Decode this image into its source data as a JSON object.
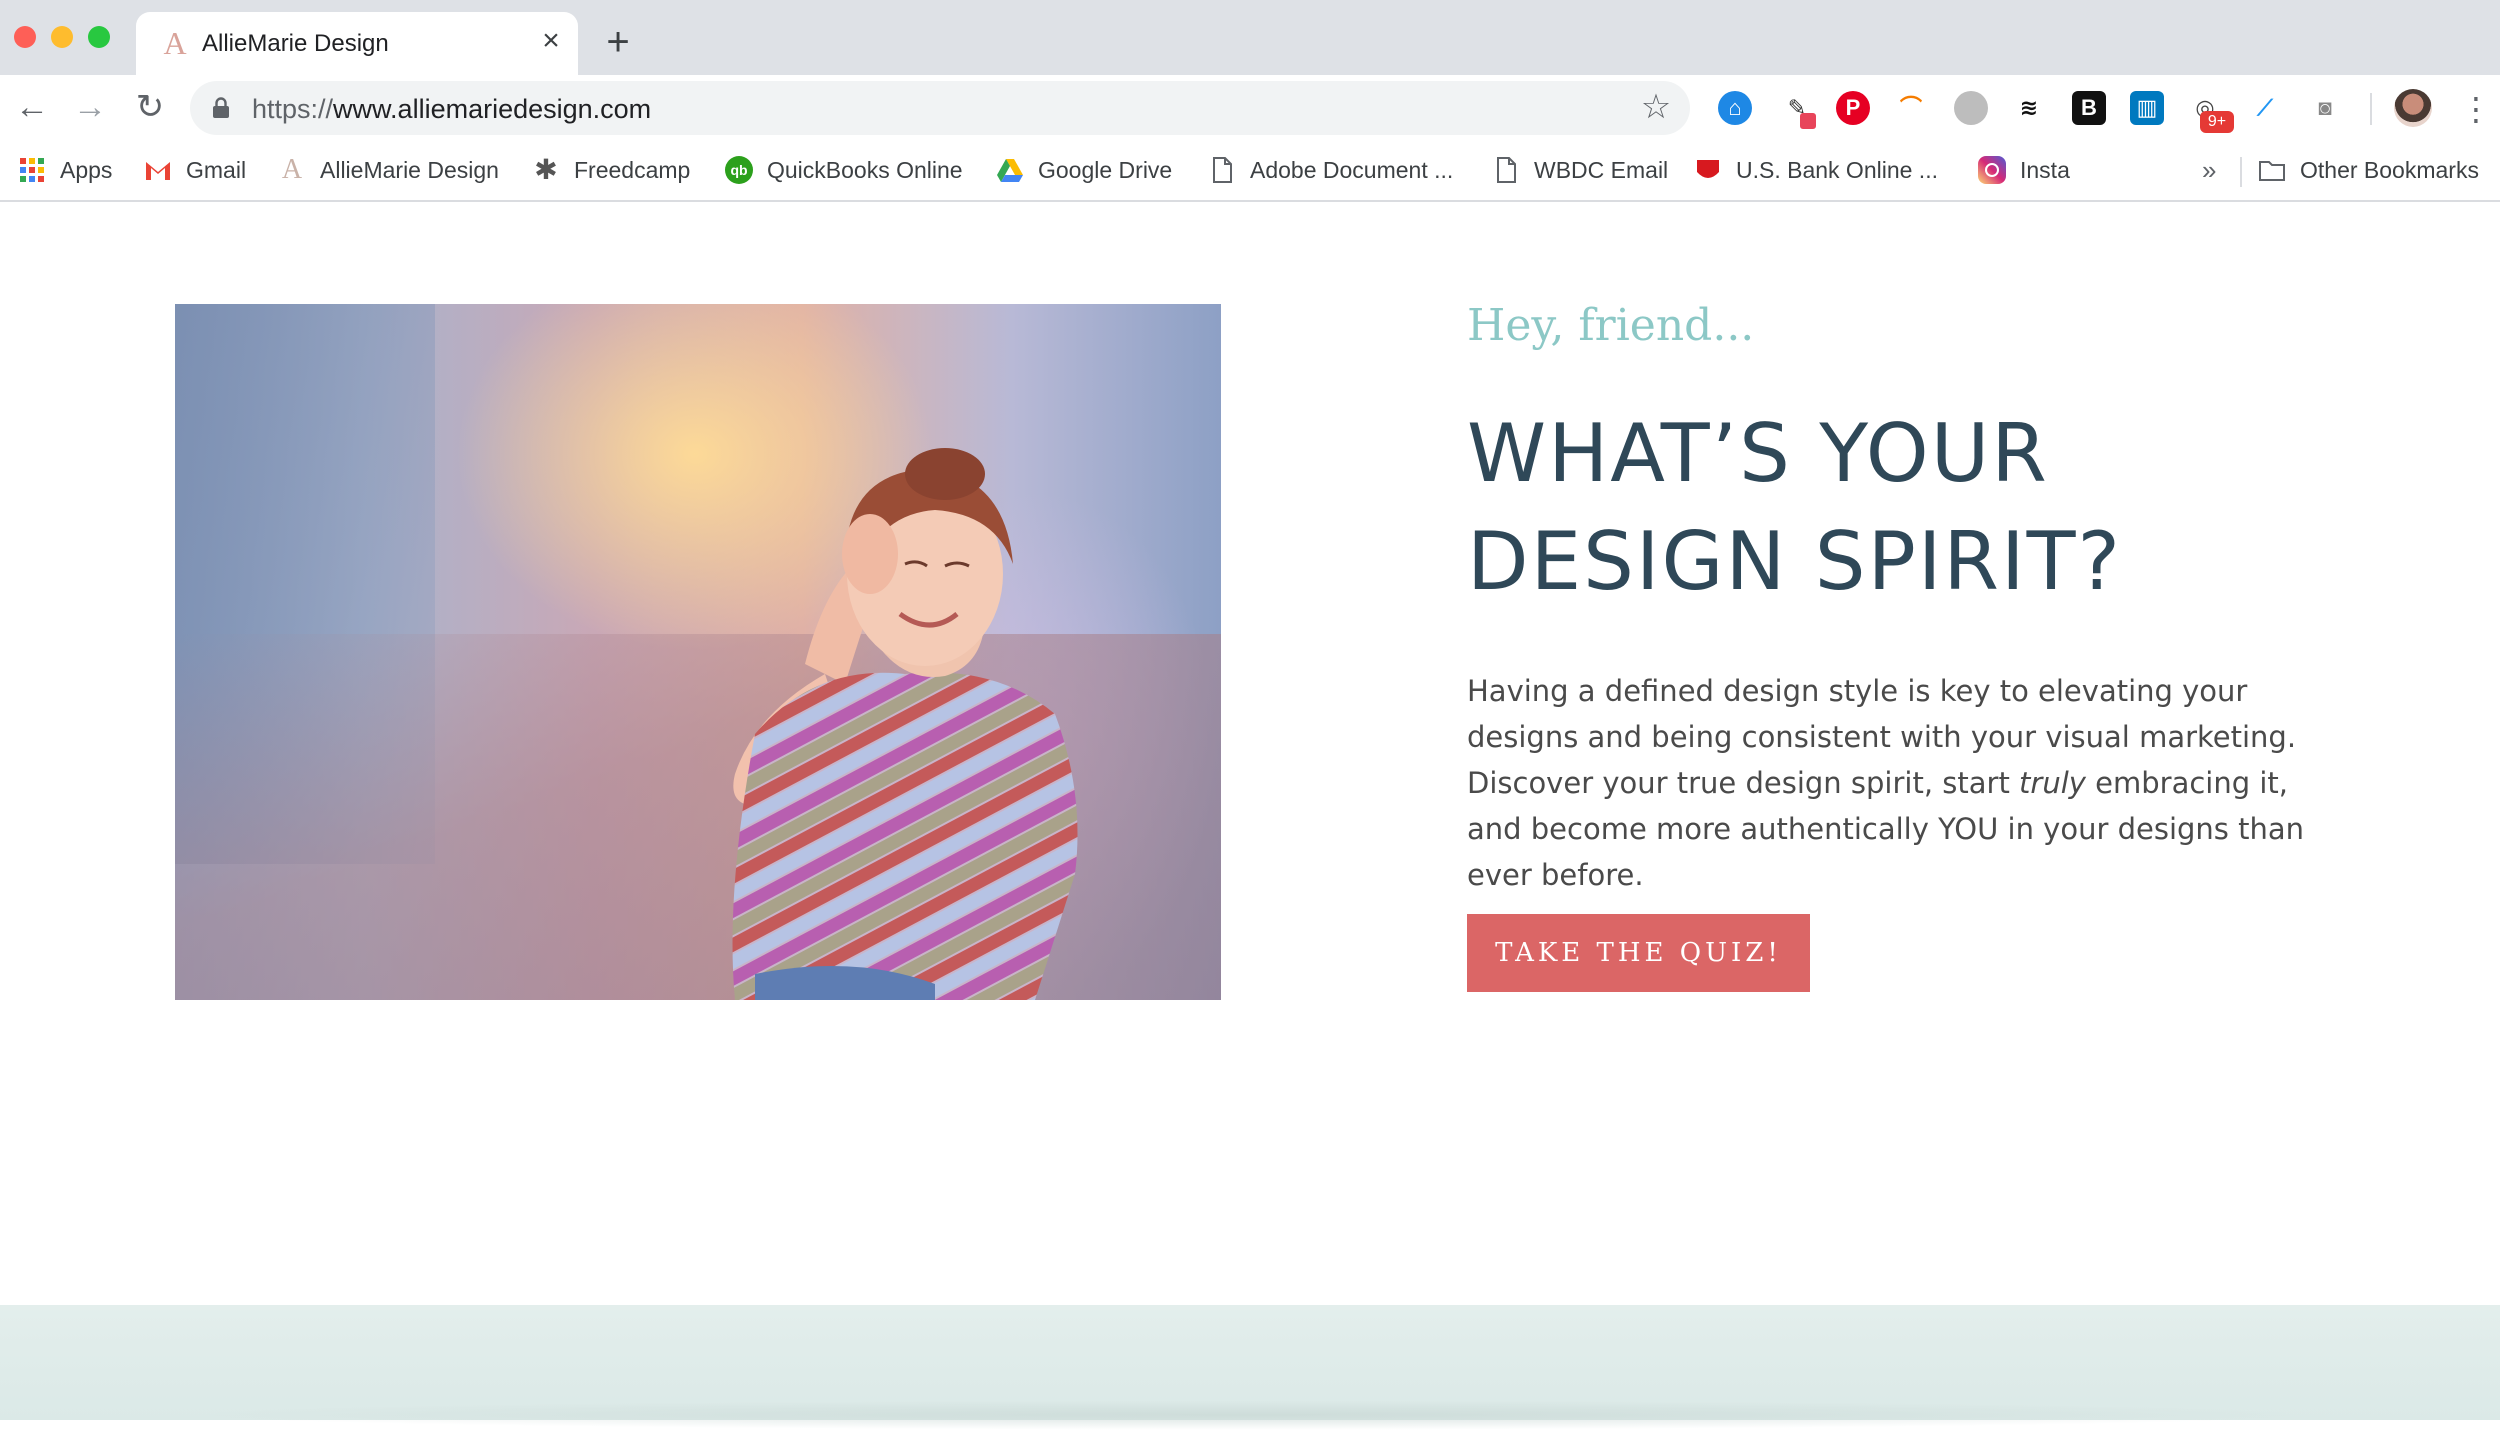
{
  "browser": {
    "tab_title": "AllieMarie Design",
    "url_scheme": "https://",
    "url_host": "www.alliemariedesign.com",
    "extension_badge": "9+",
    "extension_B": "B"
  },
  "bookmarks": [
    {
      "label": "Apps",
      "icon": "apps-grid-icon"
    },
    {
      "label": "Gmail",
      "icon": "gmail-icon"
    },
    {
      "label": "AllieMarie Design",
      "icon": "alliemarie-icon"
    },
    {
      "label": "Freedcamp",
      "icon": "freedcamp-icon"
    },
    {
      "label": "QuickBooks Online",
      "icon": "quickbooks-icon"
    },
    {
      "label": "Google Drive",
      "icon": "google-drive-icon"
    },
    {
      "label": "Adobe Document ...",
      "icon": "document-icon"
    },
    {
      "label": "WBDC Email",
      "icon": "document-icon"
    },
    {
      "label": "U.S. Bank Online ...",
      "icon": "usbank-icon"
    },
    {
      "label": "Insta",
      "icon": "instagram-icon"
    }
  ],
  "bookmarks_overflow": "»",
  "other_bookmarks": "Other Bookmarks",
  "hero": {
    "greeting": "Hey, friend...",
    "headline_line1": "WHAT’S YOUR",
    "headline_line2": "DESIGN SPIRIT?",
    "body_before": "Having a defined design style is key to elevating your designs and being consistent with your visual marketing. Discover your true design spirit, start ",
    "body_emphasis": "truly",
    "body_after": " embracing it, and become more authentically YOU in your designs than ever before.",
    "cta_label": "TAKE THE QUIZ!"
  },
  "colors": {
    "greeting": "#8cc8c6",
    "headline": "#2f4858",
    "cta_bg": "#db6666",
    "footer_band": "#dbe9e7"
  }
}
